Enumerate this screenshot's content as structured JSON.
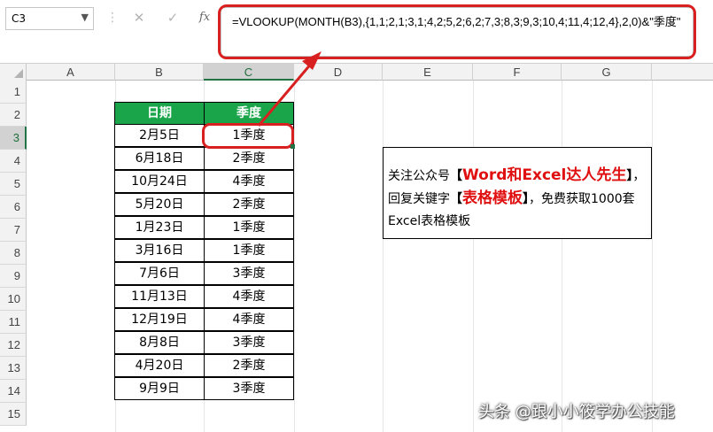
{
  "name_box": {
    "value": "C3"
  },
  "formula_bar": {
    "cancel_symbol": "✕",
    "enter_symbol": "✓",
    "function_symbol": "fx",
    "formula": "=VLOOKUP(MONTH(B3),{1,1;2,1;3,1;4,2;5,2;6,2;7,3;8,3;9,3;10,4;11,4;12,4},2,0)&\"季度\""
  },
  "columns": [
    "A",
    "B",
    "C",
    "D",
    "E",
    "F",
    "G"
  ],
  "selected_column": "C",
  "rows": [
    "1",
    "2",
    "3",
    "4",
    "5",
    "6",
    "7",
    "8",
    "9",
    "10",
    "11",
    "12",
    "13",
    "14",
    "15"
  ],
  "selected_row": "3",
  "table": {
    "headers": [
      "日期",
      "季度"
    ],
    "rows": [
      [
        "2月5日",
        "1季度"
      ],
      [
        "6月18日",
        "2季度"
      ],
      [
        "10月24日",
        "4季度"
      ],
      [
        "5月20日",
        "2季度"
      ],
      [
        "1月23日",
        "1季度"
      ],
      [
        "3月16日",
        "1季度"
      ],
      [
        "7月6日",
        "3季度"
      ],
      [
        "11月13日",
        "4季度"
      ],
      [
        "12月19日",
        "4季度"
      ],
      [
        "8月8日",
        "3季度"
      ],
      [
        "4月20日",
        "2季度"
      ],
      [
        "9月9日",
        "3季度"
      ]
    ]
  },
  "note": {
    "part1": "关注公众号",
    "bracket_open": "【",
    "highlight1": "Word和Excel达人先生",
    "bracket_close": "】",
    "part2": "，回复关键字",
    "highlight2": "表格模板",
    "part3": "，免费获取1000套Excel表格模板"
  },
  "watermark": "头条 @跟小小筱学办公技能",
  "colors": {
    "header_green": "#1aa54a",
    "annotation_red": "#d82020",
    "excel_green": "#217346"
  }
}
